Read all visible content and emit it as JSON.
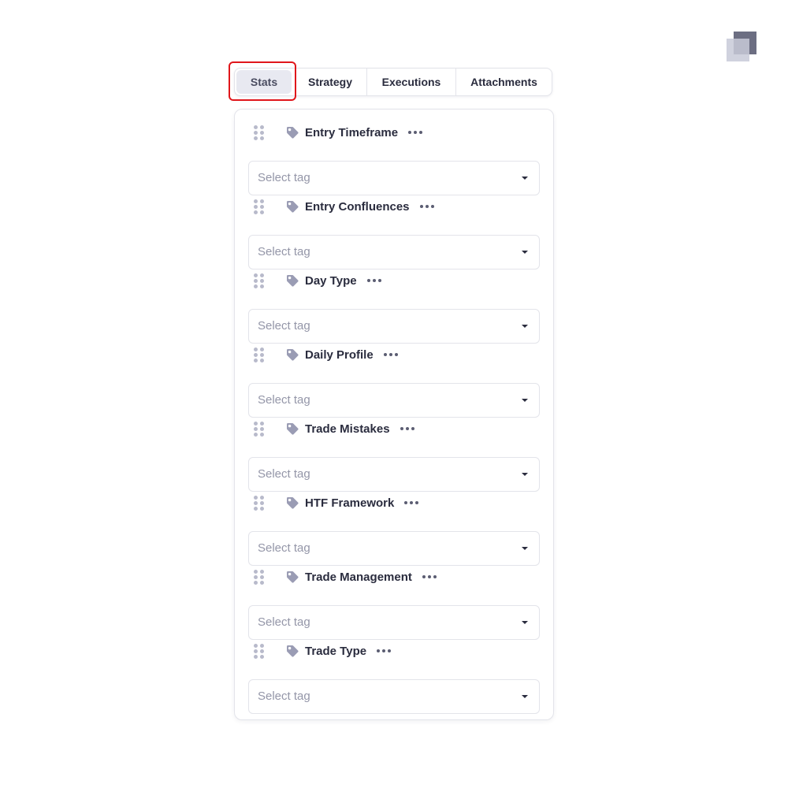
{
  "tabs": [
    {
      "label": "Stats",
      "active": true
    },
    {
      "label": "Strategy",
      "active": false
    },
    {
      "label": "Executions",
      "active": false
    },
    {
      "label": "Attachments",
      "active": false
    }
  ],
  "fields": [
    {
      "label": "Entry Timeframe",
      "placeholder": "Select tag"
    },
    {
      "label": "Entry Confluences",
      "placeholder": "Select tag"
    },
    {
      "label": "Day Type",
      "placeholder": "Select tag"
    },
    {
      "label": "Daily Profile",
      "placeholder": "Select tag"
    },
    {
      "label": "Trade Mistakes",
      "placeholder": "Select tag"
    },
    {
      "label": "HTF Framework",
      "placeholder": "Select tag"
    },
    {
      "label": "Trade Management",
      "placeholder": "Select tag"
    },
    {
      "label": "Trade Type",
      "placeholder": "Select tag"
    }
  ],
  "icons": {
    "drag": "drag-handle-icon",
    "tag": "tag-icon",
    "more": "more-options-icon",
    "caret": "caret-down-icon",
    "logo": "app-logo"
  },
  "colors": {
    "highlight": "#e0161b",
    "active_tab_bg": "#e8e9f1",
    "tag_icon": "#9a9cb4"
  }
}
